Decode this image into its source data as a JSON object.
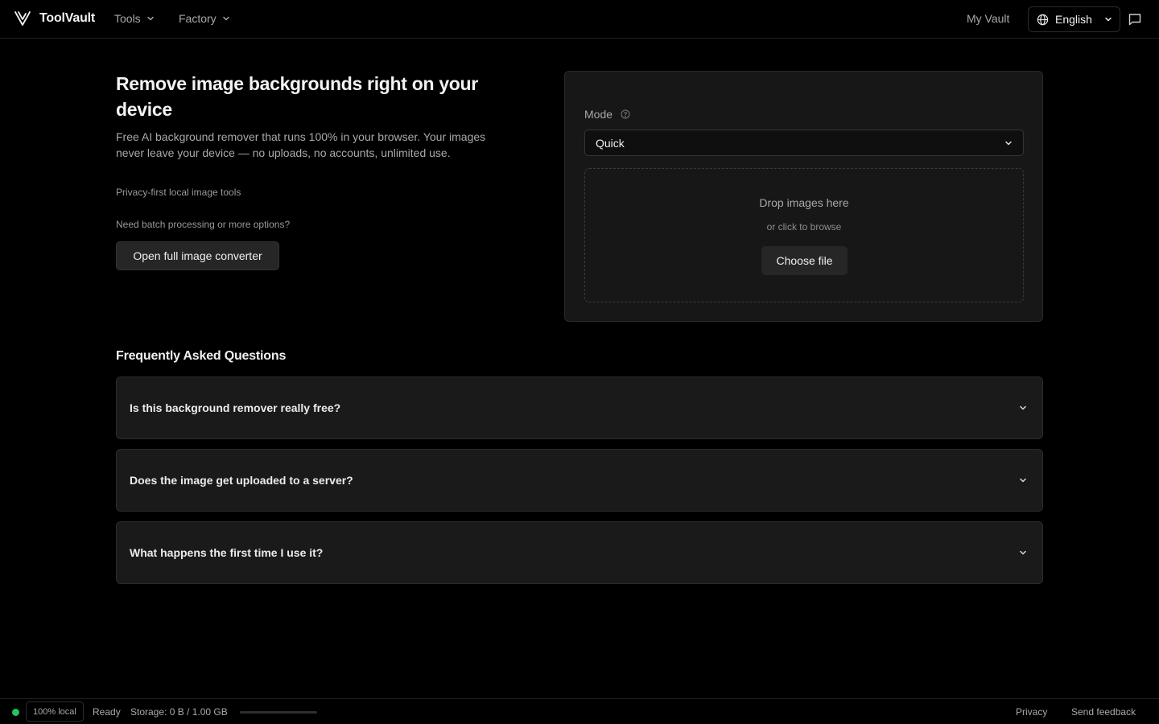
{
  "header": {
    "brand": "ToolVault",
    "nav": [
      {
        "label": "Tools"
      },
      {
        "label": "Factory"
      }
    ],
    "my_vault": "My Vault",
    "language": "English",
    "icons": {
      "logo": "toolvault-logo-icon",
      "globe": "globe-icon",
      "feedback": "message-square-icon"
    }
  },
  "hero": {
    "title": "Remove image backgrounds right on your device",
    "description": "Free AI background remover that runs 100% in your browser. Your images never leave your device — no uploads, no accounts, unlimited use.",
    "tagline": "Privacy-first local image tools",
    "batch_question": "Need batch processing or more options?",
    "open_button": "Open full image converter"
  },
  "tool": {
    "mode_label": "Mode",
    "mode_value": "Quick",
    "drop_title": "Drop images here",
    "drop_subtitle": "or click to browse",
    "choose_button": "Choose file"
  },
  "faq": {
    "title": "Frequently Asked Questions",
    "items": [
      {
        "question": "Is this background remover really free?"
      },
      {
        "question": "Does the image get uploaded to a server?"
      },
      {
        "question": "What happens the first time I use it?"
      }
    ]
  },
  "status": {
    "local_badge": "100% local",
    "state": "Ready",
    "storage": "Storage: 0 B / 1.00 GB",
    "storage_used_fraction": 0,
    "status_color": "#22c55e",
    "privacy": "Privacy",
    "send_feedback": "Send feedback"
  }
}
